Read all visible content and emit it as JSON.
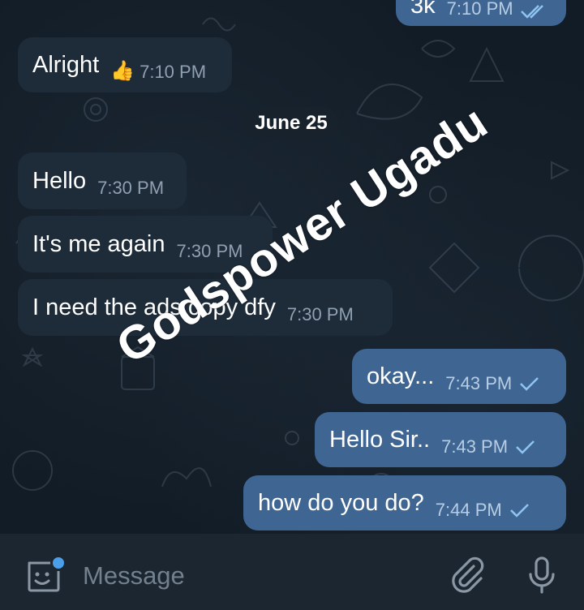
{
  "messages": [
    {
      "text": "3k",
      "time": "7:10 PM",
      "direction": "outgoing",
      "status": "read"
    },
    {
      "text": "Alright",
      "emoji": "👍",
      "time": "7:10 PM",
      "direction": "incoming"
    },
    {
      "text": "Hello",
      "time": "7:30 PM",
      "direction": "incoming"
    },
    {
      "text": "It's me again",
      "time": "7:30 PM",
      "direction": "incoming"
    },
    {
      "text": "I need the ads copy dfy",
      "time": "7:30 PM",
      "direction": "incoming"
    },
    {
      "text": "okay...",
      "time": "7:43 PM",
      "direction": "outgoing",
      "status": "sent"
    },
    {
      "text": "Hello Sir..",
      "time": "7:43 PM",
      "direction": "outgoing",
      "status": "sent"
    },
    {
      "text": "how do you do?",
      "time": "7:44 PM",
      "direction": "outgoing",
      "status": "sent"
    }
  ],
  "date_separator": "June 25",
  "watermark": "Godspower Ugadu",
  "composer": {
    "placeholder": "Message",
    "icons": [
      "sticker-icon",
      "attach-icon",
      "microphone-icon"
    ],
    "badge_color": "#4a9fe8"
  },
  "colors": {
    "incoming_bubble": "#1e2b39",
    "outgoing_bubble": "#3f6692",
    "background": "#121c26",
    "check": "#8fc4f3"
  }
}
